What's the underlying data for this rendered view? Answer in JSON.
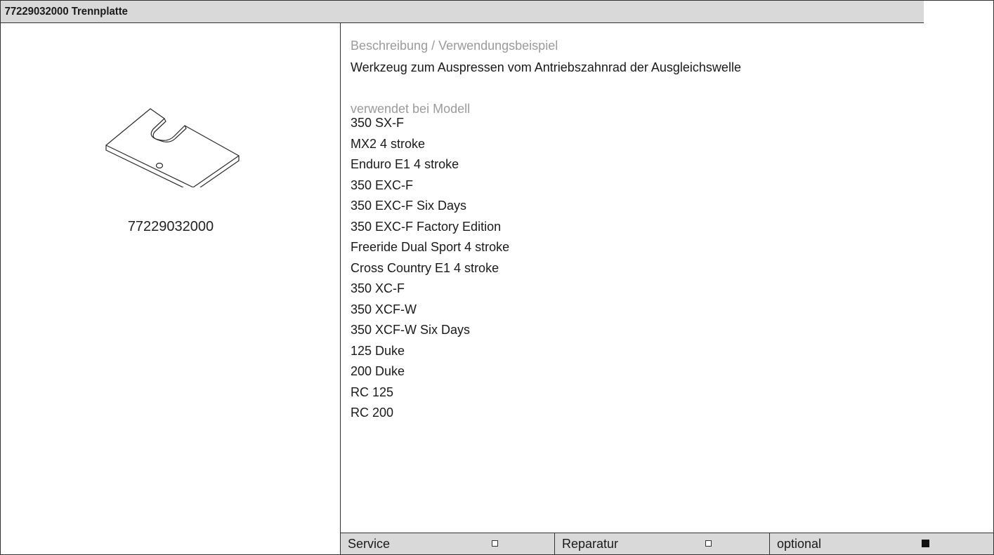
{
  "header": {
    "title": "77229032000 Trennplatte"
  },
  "image_panel": {
    "part_number": "77229032000",
    "part_icon": "separator-plate-drawing"
  },
  "description": {
    "label": "Beschreibung / Verwendungsbeispiel",
    "text": "Werkzeug zum Auspressen vom Antriebszahnrad der Ausgleichswelle"
  },
  "models": {
    "label": "verwendet bei Modell",
    "items": [
      "350 SX-F",
      "MX2 4 stroke",
      "Enduro E1 4 stroke",
      "350 EXC-F",
      "350 EXC-F Six Days",
      "350 EXC-F Factory Edition",
      "Freeride Dual Sport 4 stroke",
      "Cross Country E1 4 stroke",
      "350 XC-F",
      "350 XCF-W",
      "350 XCF-W Six Days",
      "125 Duke",
      "200 Duke",
      "RC 125",
      "RC 200"
    ]
  },
  "footer": {
    "service": {
      "label": "Service",
      "checked": false
    },
    "reparatur": {
      "label": "Reparatur",
      "checked": false
    },
    "optional": {
      "label": "optional",
      "checked": true
    }
  }
}
